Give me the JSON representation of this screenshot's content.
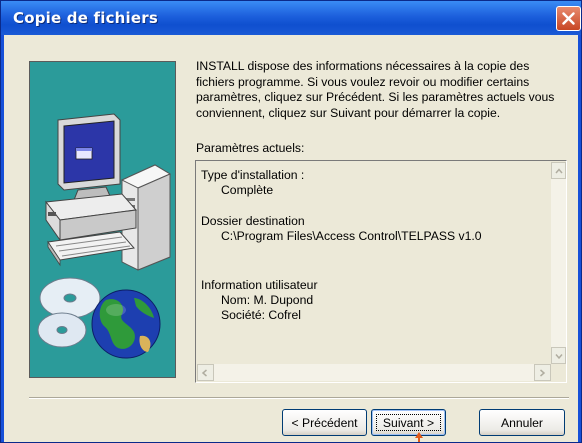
{
  "window": {
    "title": "Copie de fichiers"
  },
  "content": {
    "intro": "INSTALL dispose des informations nécessaires à la copie des fichiers programme. Si vous voulez revoir ou modifier certains paramètres, cliquez sur Précédent. Si les paramètres actuels vous conviennent, cliquez sur Suivant pour démarrer la copie.",
    "params_label": "Paramètres actuels:",
    "details": {
      "install_type_label": "Type d'installation :",
      "install_type_value": "Complète",
      "dest_label": "Dossier destination",
      "dest_value": "C:\\Program Files\\Access Control\\TELPASS v1.0",
      "user_label": "Information utilisateur",
      "user_name": "Nom:  M. Dupond",
      "user_company": "Société:  Cofrel"
    }
  },
  "buttons": {
    "back": "< Précédent",
    "next": "Suivant >",
    "cancel": "Annuler"
  },
  "icons": {
    "close": "close-icon",
    "scroll_up": "chevron-up-icon",
    "scroll_down": "chevron-down-icon",
    "scroll_left": "chevron-left-icon",
    "scroll_right": "chevron-right-icon",
    "pointer": "mouse-pointer-icon"
  },
  "colors": {
    "titlebar": "#0f4fcf",
    "illustration_bg": "#2b9b9a",
    "dialog_bg": "#ece9d8",
    "close_button": "#c84624",
    "cursor": "#e05a1a"
  }
}
